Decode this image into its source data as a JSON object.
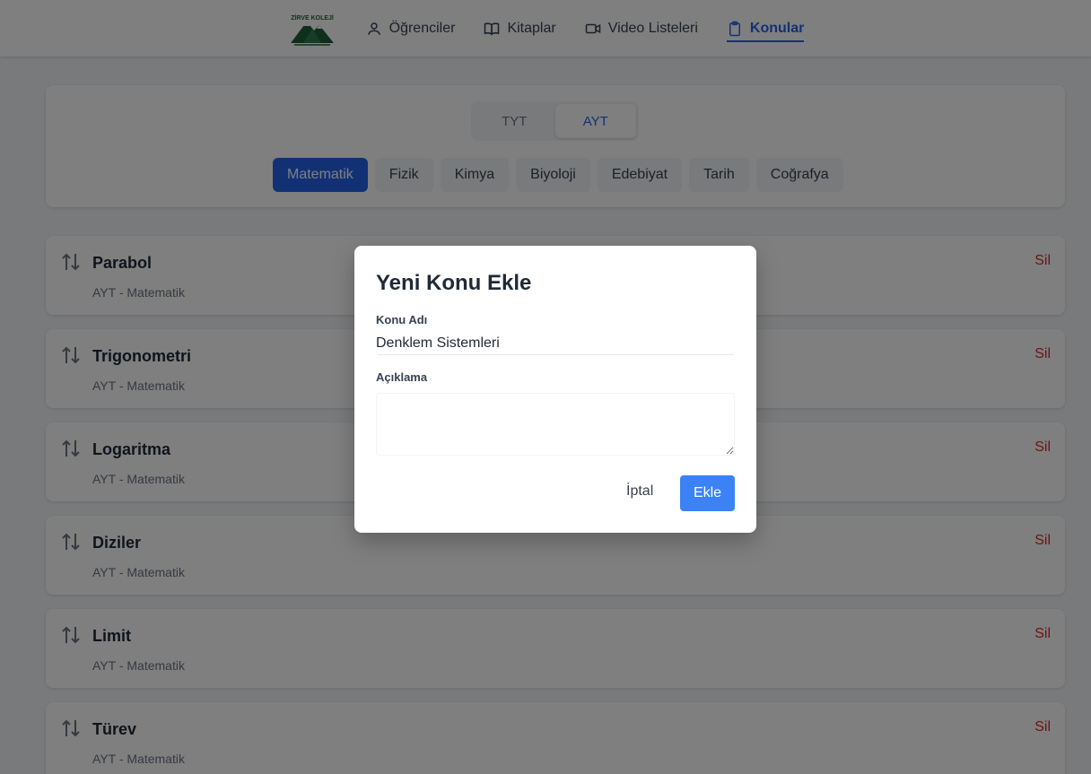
{
  "nav": {
    "logo_text": "ZİRVE KOLEJİ",
    "items": [
      {
        "label": "Öğrenciler",
        "icon": "user-icon",
        "active": false
      },
      {
        "label": "Kitaplar",
        "icon": "book-icon",
        "active": false
      },
      {
        "label": "Video Listeleri",
        "icon": "video-icon",
        "active": false
      },
      {
        "label": "Konular",
        "icon": "clipboard-icon",
        "active": true
      }
    ]
  },
  "filters": {
    "exam_types": [
      "TYT",
      "AYT"
    ],
    "selected_exam": "AYT",
    "subjects": [
      "Matematik",
      "Fizik",
      "Kimya",
      "Biyoloji",
      "Edebiyat",
      "Tarih",
      "Coğrafya"
    ],
    "selected_subject": "Matematik"
  },
  "topics": [
    {
      "name": "Parabol",
      "meta": "AYT - Matematik",
      "delete_label": "Sil"
    },
    {
      "name": "Trigonometri",
      "meta": "AYT - Matematik",
      "delete_label": "Sil"
    },
    {
      "name": "Logaritma",
      "meta": "AYT - Matematik",
      "delete_label": "Sil"
    },
    {
      "name": "Diziler",
      "meta": "AYT - Matematik",
      "delete_label": "Sil"
    },
    {
      "name": "Limit",
      "meta": "AYT - Matematik",
      "delete_label": "Sil"
    },
    {
      "name": "Türev",
      "meta": "AYT - Matematik",
      "delete_label": "Sil"
    }
  ],
  "modal": {
    "title": "Yeni Konu Ekle",
    "name_label": "Konu Adı",
    "name_value": "Denklem Sistemleri",
    "description_label": "Açıklama",
    "description_value": "",
    "cancel_label": "İptal",
    "submit_label": "Ekle"
  },
  "colors": {
    "primary": "#2563eb",
    "submit": "#3b82f6",
    "danger": "#dc2626",
    "logo_green": "#1f5f3a"
  }
}
